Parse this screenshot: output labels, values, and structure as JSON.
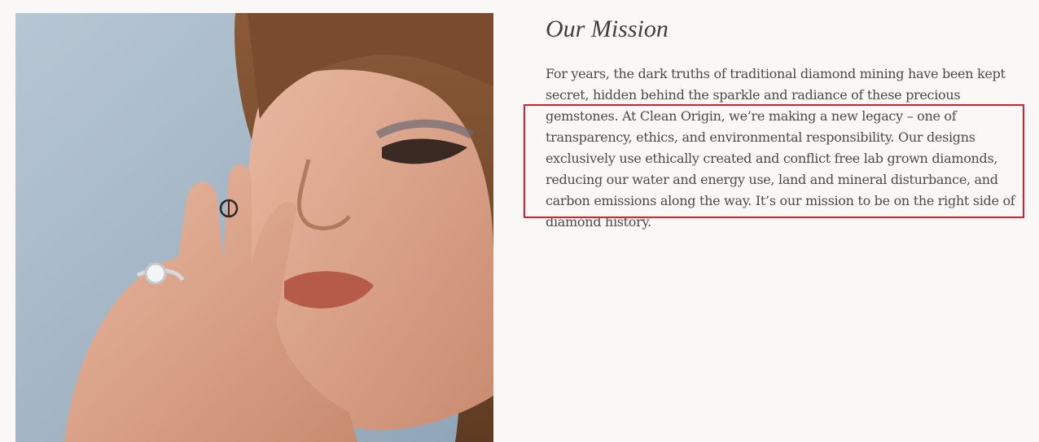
{
  "mission": {
    "title": "Our Mission",
    "paragraph": "For years, the dark truths of traditional diamond mining have been kept secret, hidden behind the sparkle and radiance of these precious gemstones. At Clean Origin, we’re making a new legacy – one of transparency, ethics, and environmental responsibility. Our designs exclusively use ethically created and conflict free lab grown diamonds, reducing our water and energy use, land and mineral disturbance, and carbon emissions along the way. It’s our mission to be on the right side of diamond history."
  },
  "colors": {
    "background": "#f9f8f6",
    "text": "#4a4a4a",
    "highlight_box": "#dd1f2a"
  }
}
